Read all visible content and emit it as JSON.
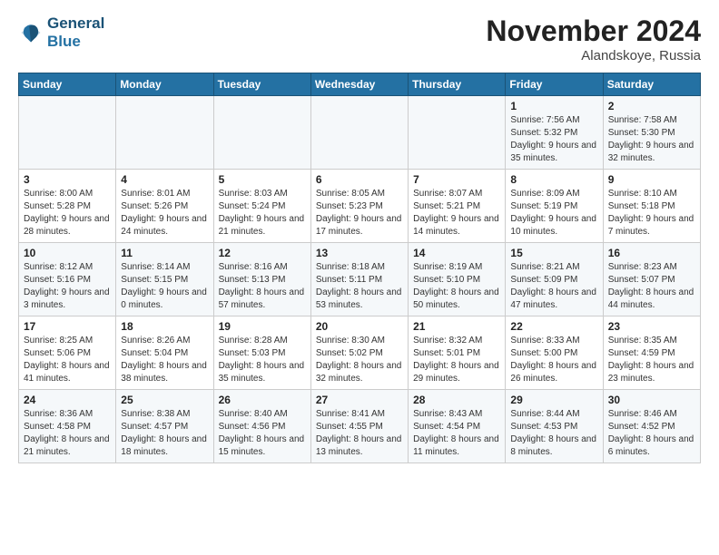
{
  "logo": {
    "line1": "General",
    "line2": "Blue"
  },
  "title": "November 2024",
  "location": "Alandskoye, Russia",
  "days_of_week": [
    "Sunday",
    "Monday",
    "Tuesday",
    "Wednesday",
    "Thursday",
    "Friday",
    "Saturday"
  ],
  "weeks": [
    [
      {
        "day": "",
        "info": ""
      },
      {
        "day": "",
        "info": ""
      },
      {
        "day": "",
        "info": ""
      },
      {
        "day": "",
        "info": ""
      },
      {
        "day": "",
        "info": ""
      },
      {
        "day": "1",
        "info": "Sunrise: 7:56 AM\nSunset: 5:32 PM\nDaylight: 9 hours and 35 minutes."
      },
      {
        "day": "2",
        "info": "Sunrise: 7:58 AM\nSunset: 5:30 PM\nDaylight: 9 hours and 32 minutes."
      }
    ],
    [
      {
        "day": "3",
        "info": "Sunrise: 8:00 AM\nSunset: 5:28 PM\nDaylight: 9 hours and 28 minutes."
      },
      {
        "day": "4",
        "info": "Sunrise: 8:01 AM\nSunset: 5:26 PM\nDaylight: 9 hours and 24 minutes."
      },
      {
        "day": "5",
        "info": "Sunrise: 8:03 AM\nSunset: 5:24 PM\nDaylight: 9 hours and 21 minutes."
      },
      {
        "day": "6",
        "info": "Sunrise: 8:05 AM\nSunset: 5:23 PM\nDaylight: 9 hours and 17 minutes."
      },
      {
        "day": "7",
        "info": "Sunrise: 8:07 AM\nSunset: 5:21 PM\nDaylight: 9 hours and 14 minutes."
      },
      {
        "day": "8",
        "info": "Sunrise: 8:09 AM\nSunset: 5:19 PM\nDaylight: 9 hours and 10 minutes."
      },
      {
        "day": "9",
        "info": "Sunrise: 8:10 AM\nSunset: 5:18 PM\nDaylight: 9 hours and 7 minutes."
      }
    ],
    [
      {
        "day": "10",
        "info": "Sunrise: 8:12 AM\nSunset: 5:16 PM\nDaylight: 9 hours and 3 minutes."
      },
      {
        "day": "11",
        "info": "Sunrise: 8:14 AM\nSunset: 5:15 PM\nDaylight: 9 hours and 0 minutes."
      },
      {
        "day": "12",
        "info": "Sunrise: 8:16 AM\nSunset: 5:13 PM\nDaylight: 8 hours and 57 minutes."
      },
      {
        "day": "13",
        "info": "Sunrise: 8:18 AM\nSunset: 5:11 PM\nDaylight: 8 hours and 53 minutes."
      },
      {
        "day": "14",
        "info": "Sunrise: 8:19 AM\nSunset: 5:10 PM\nDaylight: 8 hours and 50 minutes."
      },
      {
        "day": "15",
        "info": "Sunrise: 8:21 AM\nSunset: 5:09 PM\nDaylight: 8 hours and 47 minutes."
      },
      {
        "day": "16",
        "info": "Sunrise: 8:23 AM\nSunset: 5:07 PM\nDaylight: 8 hours and 44 minutes."
      }
    ],
    [
      {
        "day": "17",
        "info": "Sunrise: 8:25 AM\nSunset: 5:06 PM\nDaylight: 8 hours and 41 minutes."
      },
      {
        "day": "18",
        "info": "Sunrise: 8:26 AM\nSunset: 5:04 PM\nDaylight: 8 hours and 38 minutes."
      },
      {
        "day": "19",
        "info": "Sunrise: 8:28 AM\nSunset: 5:03 PM\nDaylight: 8 hours and 35 minutes."
      },
      {
        "day": "20",
        "info": "Sunrise: 8:30 AM\nSunset: 5:02 PM\nDaylight: 8 hours and 32 minutes."
      },
      {
        "day": "21",
        "info": "Sunrise: 8:32 AM\nSunset: 5:01 PM\nDaylight: 8 hours and 29 minutes."
      },
      {
        "day": "22",
        "info": "Sunrise: 8:33 AM\nSunset: 5:00 PM\nDaylight: 8 hours and 26 minutes."
      },
      {
        "day": "23",
        "info": "Sunrise: 8:35 AM\nSunset: 4:59 PM\nDaylight: 8 hours and 23 minutes."
      }
    ],
    [
      {
        "day": "24",
        "info": "Sunrise: 8:36 AM\nSunset: 4:58 PM\nDaylight: 8 hours and 21 minutes."
      },
      {
        "day": "25",
        "info": "Sunrise: 8:38 AM\nSunset: 4:57 PM\nDaylight: 8 hours and 18 minutes."
      },
      {
        "day": "26",
        "info": "Sunrise: 8:40 AM\nSunset: 4:56 PM\nDaylight: 8 hours and 15 minutes."
      },
      {
        "day": "27",
        "info": "Sunrise: 8:41 AM\nSunset: 4:55 PM\nDaylight: 8 hours and 13 minutes."
      },
      {
        "day": "28",
        "info": "Sunrise: 8:43 AM\nSunset: 4:54 PM\nDaylight: 8 hours and 11 minutes."
      },
      {
        "day": "29",
        "info": "Sunrise: 8:44 AM\nSunset: 4:53 PM\nDaylight: 8 hours and 8 minutes."
      },
      {
        "day": "30",
        "info": "Sunrise: 8:46 AM\nSunset: 4:52 PM\nDaylight: 8 hours and 6 minutes."
      }
    ]
  ]
}
